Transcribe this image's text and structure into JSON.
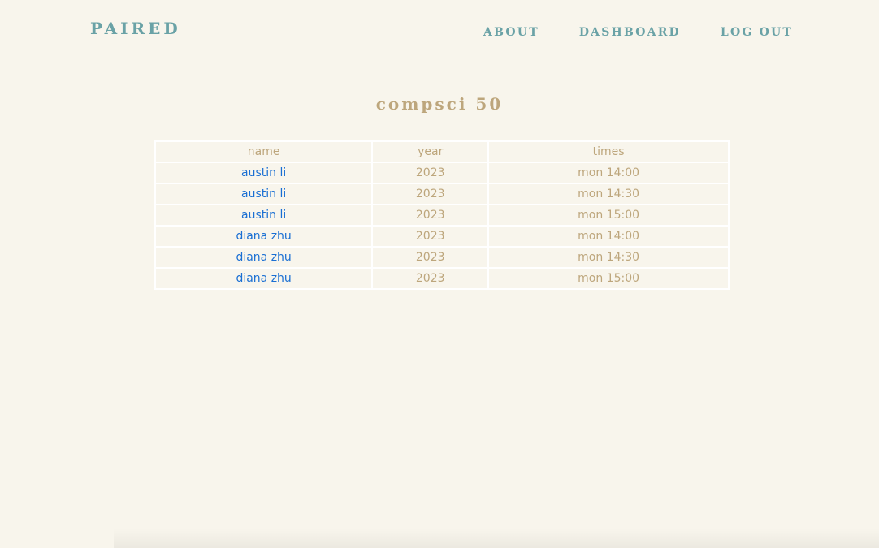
{
  "brand": "PAIRED",
  "nav": {
    "about": "ABOUT",
    "dashboard": "DASHBOARD",
    "logout": "LOG OUT"
  },
  "page_title": "compsci 50",
  "table": {
    "headers": [
      "name",
      "year",
      "times"
    ],
    "rows": [
      {
        "name": "austin li",
        "year": "2023",
        "time": "mon 14:00"
      },
      {
        "name": "austin li",
        "year": "2023",
        "time": "mon 14:30"
      },
      {
        "name": "austin li",
        "year": "2023",
        "time": "mon 15:00"
      },
      {
        "name": "diana zhu",
        "year": "2023",
        "time": "mon 14:00"
      },
      {
        "name": "diana zhu",
        "year": "2023",
        "time": "mon 14:30"
      },
      {
        "name": "diana zhu",
        "year": "2023",
        "time": "mon 15:00"
      }
    ]
  },
  "colors": {
    "background": "#f8f5ec",
    "brand_teal": "#6aa2a6",
    "tan_text": "#bda67c",
    "link_blue": "#1a6fd3"
  }
}
